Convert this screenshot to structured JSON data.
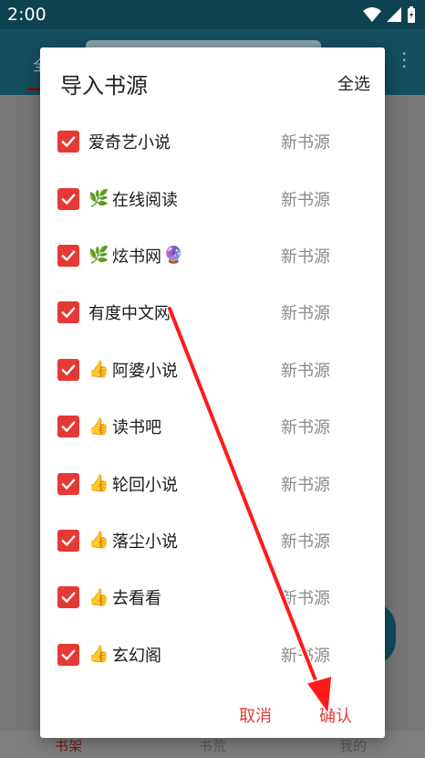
{
  "status_bar": {
    "time": "2:00"
  },
  "app": {
    "tab_left_partial": "全",
    "bottom_nav": {
      "shelf": "书架",
      "find": "书荒",
      "mine": "我的"
    }
  },
  "dialog": {
    "title": "导入书源",
    "select_all": "全选",
    "items": [
      {
        "name": "爱奇艺小说",
        "tag": "新书源",
        "emoji": "",
        "trail": ""
      },
      {
        "name": "在线阅读",
        "tag": "新书源",
        "emoji": "🌿",
        "trail": ""
      },
      {
        "name": "炫书网",
        "tag": "新书源",
        "emoji": "🌿",
        "trail": "🔮"
      },
      {
        "name": "有度中文网",
        "tag": "新书源",
        "emoji": "",
        "trail": ""
      },
      {
        "name": "阿婆小说",
        "tag": "新书源",
        "emoji": "👍",
        "trail": ""
      },
      {
        "name": "读书吧",
        "tag": "新书源",
        "emoji": "👍",
        "trail": ""
      },
      {
        "name": "轮回小说",
        "tag": "新书源",
        "emoji": "👍",
        "trail": ""
      },
      {
        "name": "落尘小说",
        "tag": "新书源",
        "emoji": "👍",
        "trail": ""
      },
      {
        "name": "去看看",
        "tag": "新书源",
        "emoji": "👍",
        "trail": ""
      },
      {
        "name": "玄幻阁",
        "tag": "新书源",
        "emoji": "👍",
        "trail": ""
      }
    ],
    "cancel_label": "取消",
    "confirm_label": "确认"
  },
  "colors": {
    "accent": "#e53935",
    "header": "#144f60",
    "status_bar": "#0e4251"
  }
}
